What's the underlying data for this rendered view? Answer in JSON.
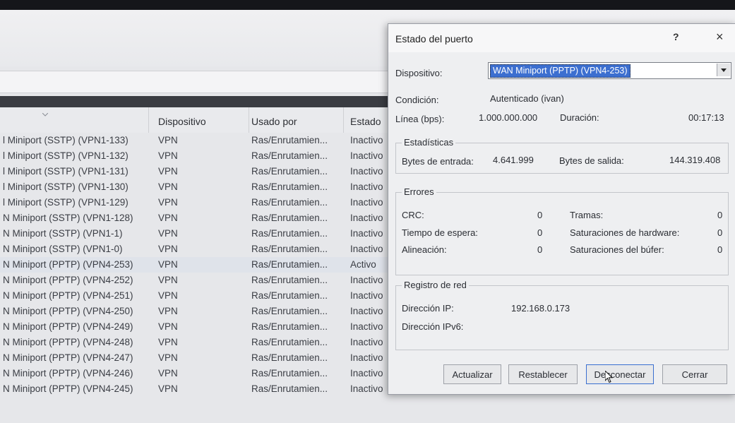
{
  "list": {
    "columns": {
      "device": "Dispositivo",
      "used_by": "Usado por",
      "state": "Estado"
    },
    "rows": [
      {
        "name": "l Miniport (SSTP) (VPN1-133)",
        "device": "VPN",
        "used_by": "Ras/Enrutamien...",
        "state": "Inactivo"
      },
      {
        "name": "l Miniport (SSTP) (VPN1-132)",
        "device": "VPN",
        "used_by": "Ras/Enrutamien...",
        "state": "Inactivo"
      },
      {
        "name": "l Miniport (SSTP) (VPN1-131)",
        "device": "VPN",
        "used_by": "Ras/Enrutamien...",
        "state": "Inactivo"
      },
      {
        "name": "l Miniport (SSTP) (VPN1-130)",
        "device": "VPN",
        "used_by": "Ras/Enrutamien...",
        "state": "Inactivo"
      },
      {
        "name": "l Miniport (SSTP) (VPN1-129)",
        "device": "VPN",
        "used_by": "Ras/Enrutamien...",
        "state": "Inactivo"
      },
      {
        "name": "N Miniport (SSTP) (VPN1-128)",
        "device": "VPN",
        "used_by": "Ras/Enrutamien...",
        "state": "Inactivo"
      },
      {
        "name": "N Miniport (SSTP) (VPN1-1)",
        "device": "VPN",
        "used_by": "Ras/Enrutamien...",
        "state": "Inactivo"
      },
      {
        "name": "N Miniport (SSTP) (VPN1-0)",
        "device": "VPN",
        "used_by": "Ras/Enrutamien...",
        "state": "Inactivo"
      },
      {
        "name": "N Miniport (PPTP) (VPN4-253)",
        "device": "VPN",
        "used_by": "Ras/Enrutamien...",
        "state": "Activo"
      },
      {
        "name": "N Miniport (PPTP) (VPN4-252)",
        "device": "VPN",
        "used_by": "Ras/Enrutamien...",
        "state": "Inactivo"
      },
      {
        "name": "N Miniport (PPTP) (VPN4-251)",
        "device": "VPN",
        "used_by": "Ras/Enrutamien...",
        "state": "Inactivo"
      },
      {
        "name": "N Miniport (PPTP) (VPN4-250)",
        "device": "VPN",
        "used_by": "Ras/Enrutamien...",
        "state": "Inactivo"
      },
      {
        "name": "N Miniport (PPTP) (VPN4-249)",
        "device": "VPN",
        "used_by": "Ras/Enrutamien...",
        "state": "Inactivo"
      },
      {
        "name": "N Miniport (PPTP) (VPN4-248)",
        "device": "VPN",
        "used_by": "Ras/Enrutamien...",
        "state": "Inactivo"
      },
      {
        "name": "N Miniport (PPTP) (VPN4-247)",
        "device": "VPN",
        "used_by": "Ras/Enrutamien...",
        "state": "Inactivo"
      },
      {
        "name": "N Miniport (PPTP) (VPN4-246)",
        "device": "VPN",
        "used_by": "Ras/Enrutamien...",
        "state": "Inactivo"
      },
      {
        "name": "N Miniport (PPTP) (VPN4-245)",
        "device": "VPN",
        "used_by": "Ras/Enrutamien...",
        "state": "Inactivo"
      }
    ]
  },
  "dialog": {
    "title": "Estado del puerto",
    "help_symbol": "?",
    "close_symbol": "×",
    "device_label": "Dispositivo:",
    "device_value": "WAN Miniport (PPTP) (VPN4-253)",
    "condition_label": "Condición:",
    "condition_value": "Autenticado (ivan)",
    "line_label": "Línea (bps):",
    "line_value": "1.000.000.000",
    "duration_label": "Duración:",
    "duration_value": "00:17:13",
    "stats": {
      "title": "Estadísticas",
      "bytes_in_label": "Bytes de entrada:",
      "bytes_in_value": "4.641.999",
      "bytes_out_label": "Bytes de salida:",
      "bytes_out_value": "144.319.408"
    },
    "errors": {
      "title": "Errores",
      "crc_label": "CRC:",
      "crc_value": "0",
      "frames_label": "Tramas:",
      "frames_value": "0",
      "timeout_label": "Tiempo de espera:",
      "timeout_value": "0",
      "hw_label": "Saturaciones de hardware:",
      "hw_value": "0",
      "align_label": "Alineación:",
      "align_value": "0",
      "buffer_label": "Saturaciones del búfer:",
      "buffer_value": "0"
    },
    "network": {
      "title": "Registro de red",
      "ip_label": "Dirección IP:",
      "ip_value": "192.168.0.173",
      "ipv6_label": "Dirección IPv6:",
      "ipv6_value": ""
    },
    "buttons": {
      "refresh": "Actualizar",
      "reset": "Restablecer",
      "disconnect": "Desconectar",
      "close": "Cerrar"
    }
  }
}
